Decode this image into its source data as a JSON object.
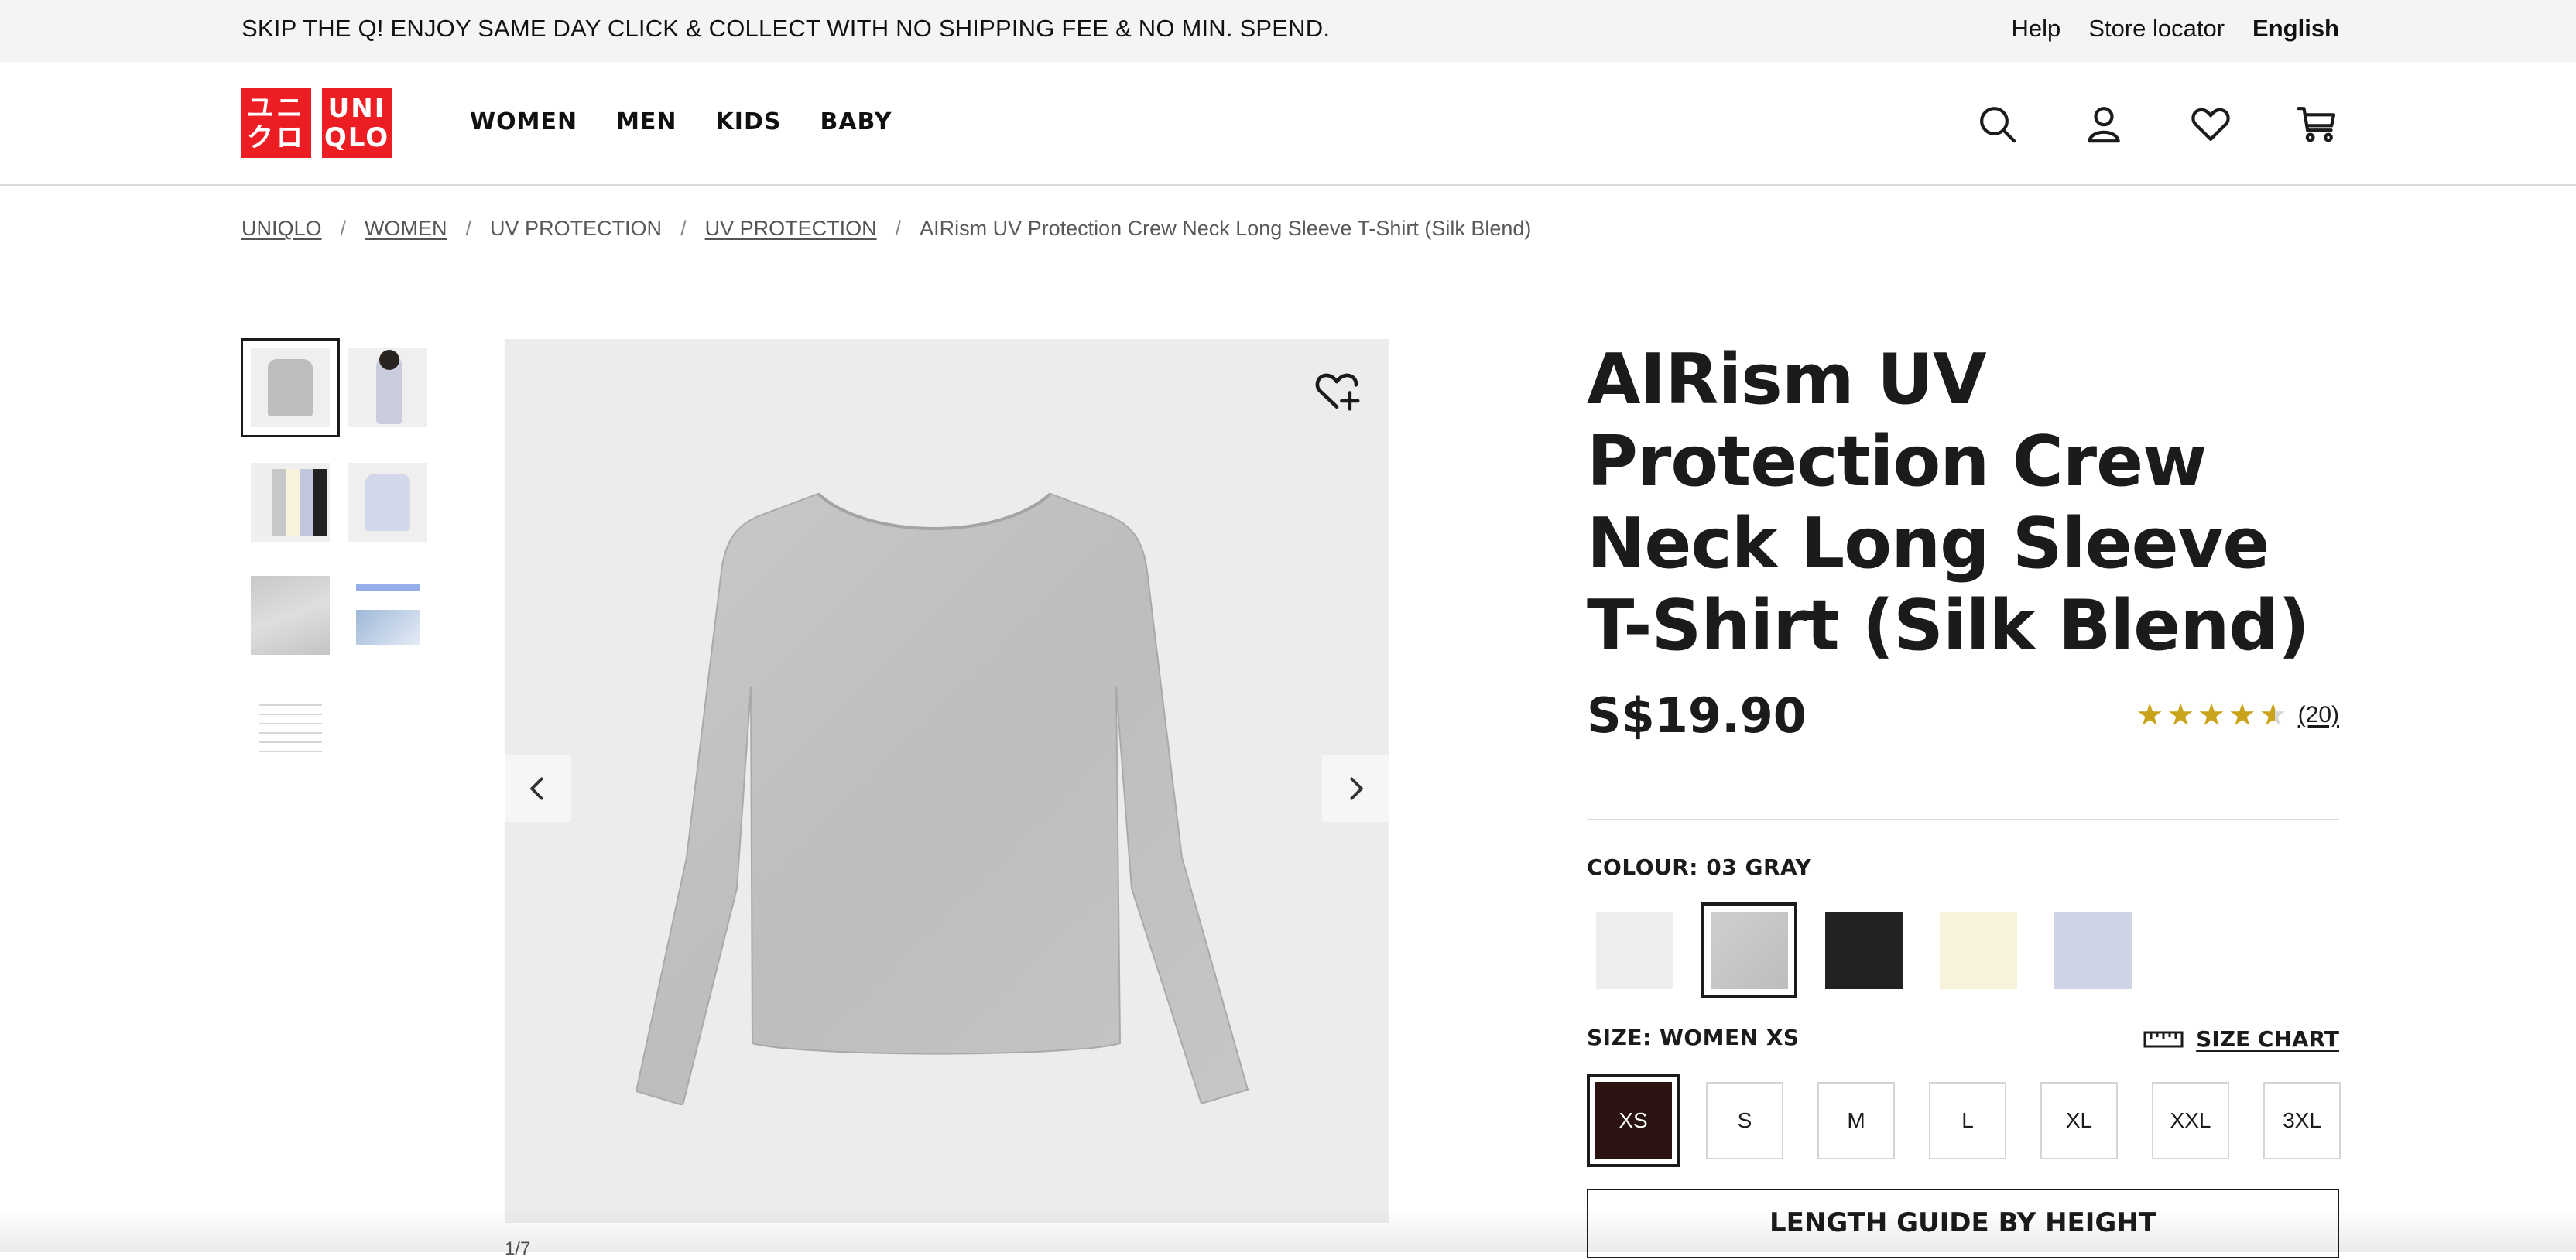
{
  "promo_bar": {
    "message": "SKIP THE Q! ENJOY SAME DAY CLICK & COLLECT WITH NO SHIPPING FEE & NO MIN. SPEND.",
    "links": {
      "help": "Help",
      "store_locator": "Store locator",
      "language": "English"
    }
  },
  "header": {
    "logo": {
      "top_left": "ユニ",
      "bottom_left": "クロ",
      "top_right": "UNI",
      "bottom_right": "QLO",
      "brand_color": "#ed1d24"
    },
    "nav": [
      "WOMEN",
      "MEN",
      "KIDS",
      "BABY"
    ],
    "icons": [
      "search-icon",
      "account-icon",
      "wishlist-icon",
      "cart-icon"
    ]
  },
  "breadcrumb": [
    {
      "label": "UNIQLO",
      "link": true
    },
    {
      "label": "WOMEN",
      "link": true
    },
    {
      "label": "UV PROTECTION",
      "link": false
    },
    {
      "label": "UV PROTECTION",
      "link": true
    },
    {
      "label": "AIRism UV Protection Crew Neck Long Sleeve T-Shirt (Silk Blend)",
      "link": false
    }
  ],
  "gallery": {
    "thumbnail_count": 7,
    "selected_index": 0,
    "counter": "1/7"
  },
  "product": {
    "title": "AIRism UV Protection Crew Neck Long Sleeve T-Shirt (Silk Blend)",
    "price": "S$19.90",
    "rating": 4.5,
    "review_count": "(20)",
    "colour_label": "COLOUR:",
    "colour_value": "03 GRAY",
    "colours": [
      {
        "name": "white",
        "hex": "#eeeeee"
      },
      {
        "name": "gray",
        "hex": "#c8c8c8",
        "selected": true
      },
      {
        "name": "black",
        "hex": "#222222"
      },
      {
        "name": "natural",
        "hex": "#f7f3dc"
      },
      {
        "name": "blue",
        "hex": "#ced3e6"
      }
    ],
    "size_label": "SIZE:",
    "size_value": "WOMEN XS",
    "size_chart": "SIZE CHART",
    "sizes": [
      "XS",
      "S",
      "M",
      "L",
      "XL",
      "XXL",
      "3XL"
    ],
    "selected_size": "XS",
    "length_guide": "LENGTH GUIDE BY HEIGHT"
  }
}
